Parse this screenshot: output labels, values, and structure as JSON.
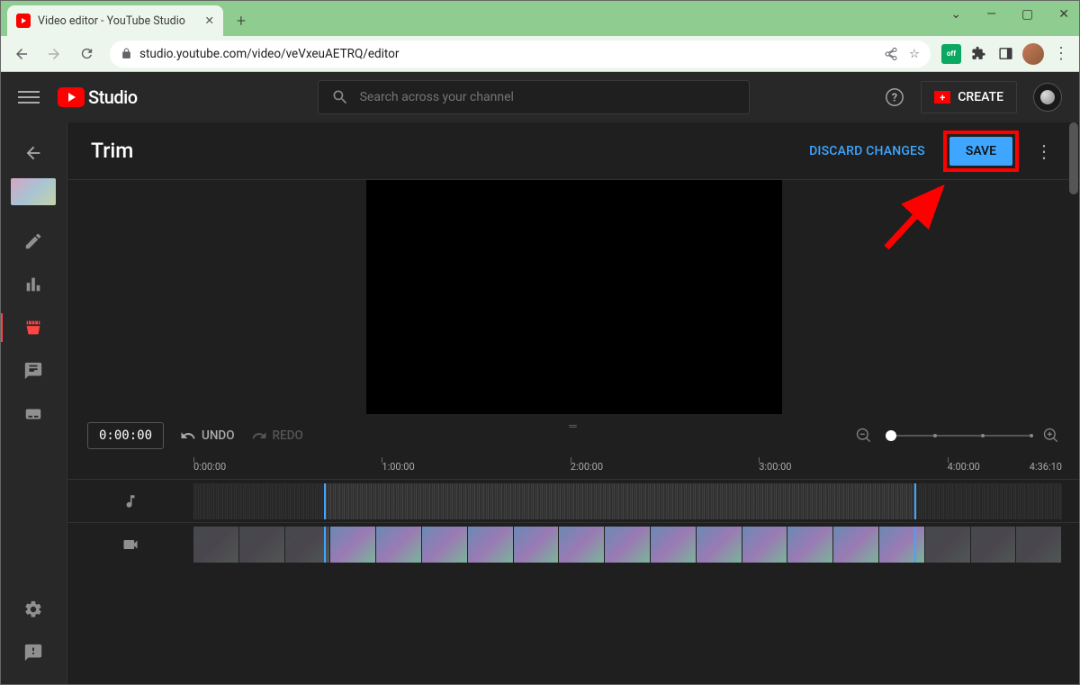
{
  "browser": {
    "tab_title": "Video editor - YouTube Studio",
    "url": "studio.youtube.com/video/veVxeuAETRQ/editor"
  },
  "header": {
    "studio_label": "Studio",
    "search_placeholder": "Search across your channel",
    "create_label": "CREATE"
  },
  "editor": {
    "title": "Trim",
    "discard_label": "DISCARD CHANGES",
    "save_label": "SAVE",
    "current_time": "0:00:00",
    "undo_label": "UNDO",
    "redo_label": "REDO",
    "duration": "4:36:10",
    "ruler_ticks": [
      "0:00:00",
      "1:00:00",
      "2:00:00",
      "3:00:00",
      "4:00:00"
    ]
  }
}
